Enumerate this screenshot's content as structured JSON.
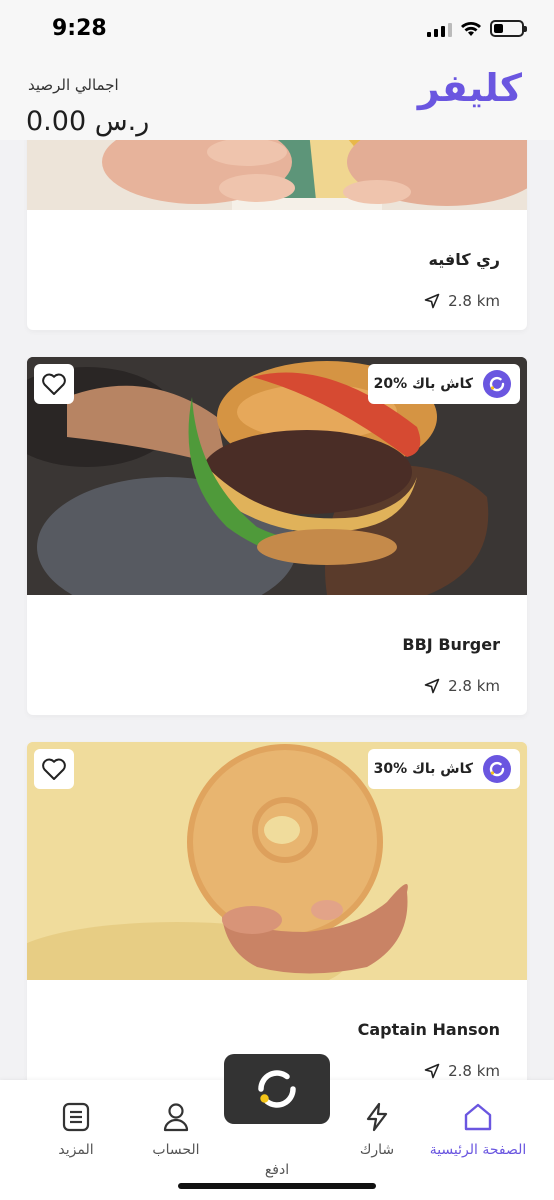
{
  "status": {
    "time": "9:28"
  },
  "header": {
    "logo": "كليفر",
    "balance_label": "اجمالي الرصيد",
    "balance_value": "ر.س 0.00"
  },
  "stores": [
    {
      "name": "ري كافيه",
      "distance": "2.8 km",
      "cashback": null
    },
    {
      "name": "BBJ Burger",
      "distance": "2.8 km",
      "cashback": "20% كاش باك"
    },
    {
      "name": "Captain Hanson",
      "distance": "2.8 km",
      "cashback": "30% كاش باك"
    }
  ],
  "nav": {
    "home": "الصفحة الرئيسية",
    "share": "شارك",
    "pay": "ادفع",
    "account": "الحساب",
    "more": "المزيد"
  },
  "colors": {
    "brand": "#6a56e0",
    "nav_inactive": "#555555",
    "pay_button": "#333333"
  },
  "icons": {
    "favorite": "heart-icon",
    "cashback": "refresh-icon",
    "distance": "navigation-arrow-icon",
    "home": "home-icon",
    "share": "lightning-icon",
    "pay": "cleaver-logo-icon",
    "account": "user-icon",
    "more": "menu-list-icon"
  }
}
